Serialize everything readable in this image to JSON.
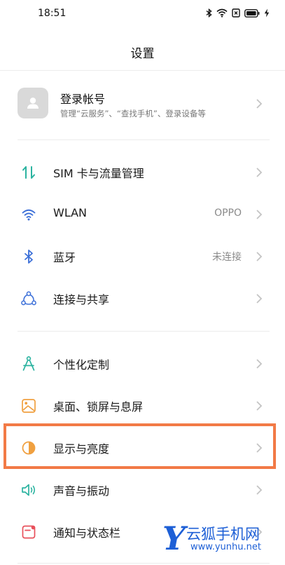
{
  "status_bar": {
    "time": "18:51"
  },
  "page": {
    "title": "设置"
  },
  "account": {
    "name": "登录帐号",
    "description": "管理“云服务”、“查找手机”、登录设备等",
    "icon": "user-icon"
  },
  "groups": [
    {
      "items": [
        {
          "label": "SIM 卡与流量管理",
          "value": "",
          "icon": "sim-data-icon",
          "color": "#2bb3a0"
        },
        {
          "label": "WLAN",
          "value": "OPPO",
          "icon": "wifi-icon",
          "color": "#3b6fd8"
        },
        {
          "label": "蓝牙",
          "value": "未连接",
          "icon": "bluetooth-icon",
          "color": "#3b6fd8"
        },
        {
          "label": "连接与共享",
          "value": "",
          "icon": "share-connect-icon",
          "color": "#3b6fd8"
        }
      ]
    },
    {
      "items": [
        {
          "label": "个性化定制",
          "value": "",
          "icon": "compass-icon",
          "color": "#2bb3a0"
        },
        {
          "label": "桌面、锁屏与息屏",
          "value": "",
          "icon": "wallpaper-icon",
          "color": "#f0a040"
        },
        {
          "label": "显示与亮度",
          "value": "",
          "icon": "brightness-icon",
          "color": "#f0a040"
        },
        {
          "label": "声音与振动",
          "value": "",
          "icon": "sound-icon",
          "color": "#2bb3a0"
        },
        {
          "label": "通知与状态栏",
          "value": "",
          "icon": "notification-icon",
          "color": "#e8505b"
        }
      ]
    }
  ],
  "watermark": {
    "mark": "Y",
    "title": "云狐手机网",
    "url": "www.yunhu.net"
  },
  "colors": {
    "highlight": "#f27a46",
    "watermark": "#1d5fd6"
  }
}
